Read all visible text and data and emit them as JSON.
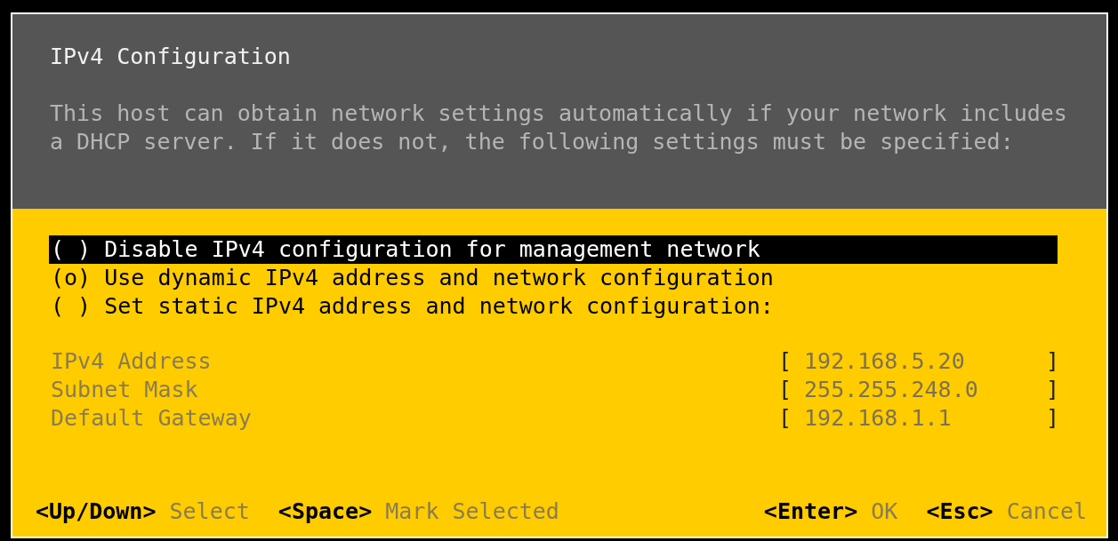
{
  "dialog": {
    "title": "IPv4 Configuration",
    "description": "This host can obtain network settings automatically if your network includes a DHCP server. If it does not, the following settings must be specified:"
  },
  "options": [
    {
      "radio": "( )",
      "label": "Disable IPv4 configuration for management network",
      "focused": true
    },
    {
      "radio": "(o)",
      "label": "Use dynamic IPv4 address and network configuration",
      "focused": false
    },
    {
      "radio": "( )",
      "label": "Set static IPv4 address and network configuration:",
      "focused": false
    }
  ],
  "fields": [
    {
      "label": "IPv4 Address",
      "open": "[",
      "value": "192.168.5.20",
      "close": "]"
    },
    {
      "label": "Subnet Mask",
      "open": "[",
      "value": "255.255.248.0",
      "close": "]"
    },
    {
      "label": "Default Gateway",
      "open": "[",
      "value": "192.168.1.1",
      "close": "]"
    }
  ],
  "footer": {
    "left": [
      {
        "key": "<Up/Down>",
        "action": "Select"
      },
      {
        "key": "<Space>",
        "action": "Mark Selected"
      }
    ],
    "right": [
      {
        "key": "<Enter>",
        "action": "OK"
      },
      {
        "key": "<Esc>",
        "action": "Cancel"
      }
    ]
  }
}
